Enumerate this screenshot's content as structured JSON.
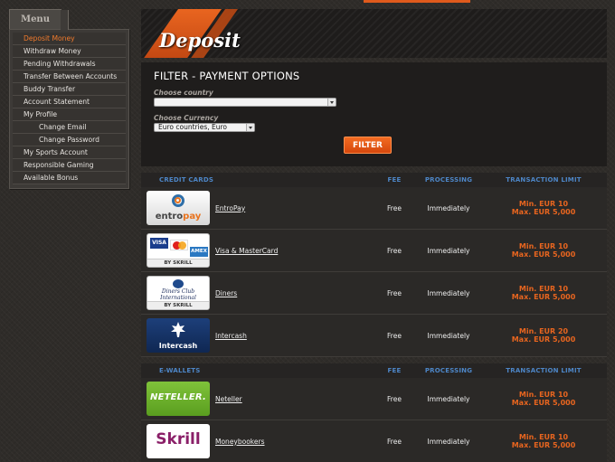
{
  "sidebar": {
    "menu_label": "Menu",
    "items": [
      {
        "label": "Deposit Money"
      },
      {
        "label": "Withdraw Money"
      },
      {
        "label": "Pending Withdrawals"
      },
      {
        "label": "Transfer Between Accounts"
      },
      {
        "label": "Buddy Transfer"
      },
      {
        "label": "Account Statement"
      },
      {
        "label": "My Profile"
      },
      {
        "label": "Change Email"
      },
      {
        "label": "Change Password"
      },
      {
        "label": "My Sports Account"
      },
      {
        "label": "Responsible Gaming"
      },
      {
        "label": "Available Bonus"
      }
    ]
  },
  "banner": {
    "title": "Deposit"
  },
  "filter": {
    "title": "FILTER - PAYMENT OPTIONS",
    "country_label": "Choose country",
    "country_value": "",
    "currency_label": "Choose Currency",
    "currency_value": "Euro countries, Euro",
    "button_label": "FILTER"
  },
  "credit_cards": {
    "headers": {
      "name": "CREDIT CARDS",
      "fee": "FEE",
      "processing": "PROCESSING",
      "limit": "TRANSACTION LIMIT"
    },
    "rows": [
      {
        "name": "EntroPay",
        "fee": "Free",
        "processing": "Immediately",
        "min": "Min. EUR 10",
        "max": "Max. EUR 5,000",
        "logo_text_a": "entro",
        "logo_text_b": "pay"
      },
      {
        "name": "Visa & MasterCard",
        "fee": "Free",
        "processing": "Immediately",
        "min": "Min. EUR 10",
        "max": "Max. EUR 5,000",
        "visa": "VISA",
        "amex": "AMEX",
        "by": "BY SKRILL"
      },
      {
        "name": "Diners",
        "fee": "Free",
        "processing": "Immediately",
        "min": "Min. EUR 10",
        "max": "Max. EUR 5,000",
        "logo_text": "Diners Club International",
        "by": "BY SKRILL"
      },
      {
        "name": "Intercash",
        "fee": "Free",
        "processing": "Immediately",
        "min": "Min. EUR 20",
        "max": "Max. EUR 5,000",
        "logo_text": "Intercash"
      }
    ]
  },
  "ewallets": {
    "headers": {
      "name": "E-WALLETS",
      "fee": "FEE",
      "processing": "PROCESSING",
      "limit": "TRANSACTION LIMIT"
    },
    "rows": [
      {
        "name": "Neteller",
        "fee": "Free",
        "processing": "Immediately",
        "min": "Min. EUR 10",
        "max": "Max. EUR 5,000",
        "logo_text": "NETELLER."
      },
      {
        "name": "Moneybookers",
        "fee": "Free",
        "processing": "Immediately",
        "min": "Min. EUR 10",
        "max": "Max. EUR 5,000",
        "logo_text": "Skrill"
      }
    ]
  },
  "colors": {
    "accent": "#e8651f",
    "header_blue": "#4d86c7"
  }
}
